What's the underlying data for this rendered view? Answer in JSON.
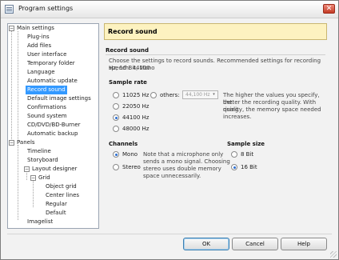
{
  "window": {
    "title": "Program settings",
    "close_label": "✕"
  },
  "tree": {
    "items": [
      {
        "label": "Main settings",
        "selected": false
      },
      {
        "label": "Plug-ins",
        "selected": false
      },
      {
        "label": "Add files",
        "selected": false
      },
      {
        "label": "User interface",
        "selected": false
      },
      {
        "label": "Temporary folder",
        "selected": false
      },
      {
        "label": "Language",
        "selected": false
      },
      {
        "label": "Automatic update",
        "selected": false
      },
      {
        "label": "Record sound",
        "selected": true
      },
      {
        "label": "Default image settings",
        "selected": false
      },
      {
        "label": "Confirmations",
        "selected": false
      },
      {
        "label": "Sound system",
        "selected": false
      },
      {
        "label": "CD/DVD/BD-Burner",
        "selected": false
      },
      {
        "label": "Automatic backup",
        "selected": false
      },
      {
        "label": "Panels",
        "selected": false
      },
      {
        "label": "Timeline",
        "selected": false
      },
      {
        "label": "Storyboard",
        "selected": false
      },
      {
        "label": "Layout designer",
        "selected": false
      },
      {
        "label": "Grid",
        "selected": false
      },
      {
        "label": "Object grid",
        "selected": false
      },
      {
        "label": "Center lines",
        "selected": false
      },
      {
        "label": "Regular",
        "selected": false
      },
      {
        "label": "Default",
        "selected": false
      },
      {
        "label": "Imagelist",
        "selected": false
      }
    ]
  },
  "panel": {
    "header_title": "Record sound",
    "section_title": "Record sound",
    "intro_line1": "Choose the settings to record sounds. Recommended settings for recording speech: 44100",
    "intro_line2": "Hz, 16 Bit, Mono",
    "sample_rate": {
      "label": "Sample rate",
      "options": [
        "11025 Hz",
        "22050 Hz",
        "44100 Hz",
        "48000 Hz"
      ],
      "selected": "44100 Hz",
      "others_label": "others:",
      "others_value": "44,100 Hz",
      "hint_line1": "The higher the values you specify, the",
      "hint_line2": "better the recording quality. With rising",
      "hint_line3": "quality, the memory space needed",
      "hint_line4": "increases."
    },
    "channels": {
      "label": "Channels",
      "options": [
        "Mono",
        "Stereo"
      ],
      "selected": "Mono",
      "note_line1": "Note that a microphone only",
      "note_line2": "sends a mono signal. Choosing",
      "note_line3": "stereo uses double memory",
      "note_line4": "space unnecessarily."
    },
    "sample_size": {
      "label": "Sample size",
      "options": [
        "8 Bit",
        "16 Bit"
      ],
      "selected": "16 Bit"
    }
  },
  "buttons": {
    "ok": "OK",
    "cancel": "Cancel",
    "help": "Help"
  }
}
